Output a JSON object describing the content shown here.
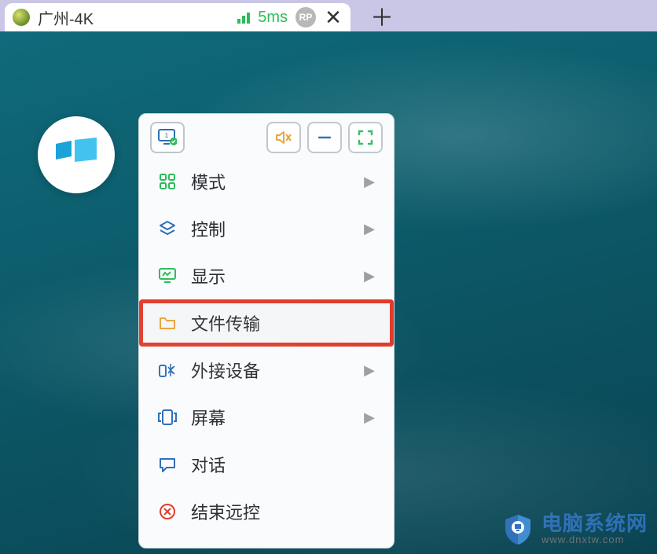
{
  "tab": {
    "title": "广州-4K",
    "latency": "5ms",
    "badge": "RP"
  },
  "menu": {
    "items": [
      {
        "label": "模式",
        "icon": "grid",
        "hasSub": true,
        "highlight": false
      },
      {
        "label": "控制",
        "icon": "layers",
        "hasSub": true,
        "highlight": false
      },
      {
        "label": "显示",
        "icon": "monitor",
        "hasSub": true,
        "highlight": false
      },
      {
        "label": "文件传输",
        "icon": "folder",
        "hasSub": false,
        "highlight": true
      },
      {
        "label": "外接设备",
        "icon": "devices",
        "hasSub": true,
        "highlight": false
      },
      {
        "label": "屏幕",
        "icon": "screens",
        "hasSub": true,
        "highlight": false
      },
      {
        "label": "对话",
        "icon": "chat",
        "hasSub": false,
        "highlight": false
      },
      {
        "label": "结束远控",
        "icon": "close",
        "hasSub": false,
        "highlight": false
      }
    ]
  },
  "watermark": {
    "title": "电脑系统网",
    "url": "www.dnxtw.com"
  },
  "colors": {
    "accentBlue": "#2d6fb7",
    "accentGreen": "#2bbd5a",
    "accentOrange": "#e8a13a",
    "accentRed": "#e03a2a"
  }
}
